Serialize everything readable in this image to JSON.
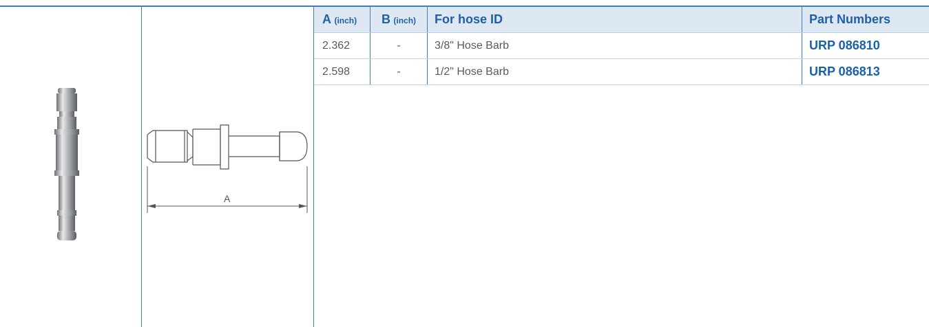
{
  "table": {
    "headers": {
      "a": "A",
      "a_unit": "(inch)",
      "b": "B",
      "b_unit": "(inch)",
      "hose": "For hose ID",
      "part": "Part Numbers"
    },
    "rows": [
      {
        "a": "2.362",
        "b": "-",
        "hose": "3/8\" Hose Barb",
        "part": "URP 086810"
      },
      {
        "a": "2.598",
        "b": "-",
        "hose": "1/2\" Hose Barb",
        "part": "URP 086813"
      }
    ]
  },
  "drawing": {
    "dimension_label": "A"
  },
  "colors": {
    "accent": "#3f7bbf",
    "header_bg": "#dde8f2",
    "part_link": "#1a60aa"
  }
}
